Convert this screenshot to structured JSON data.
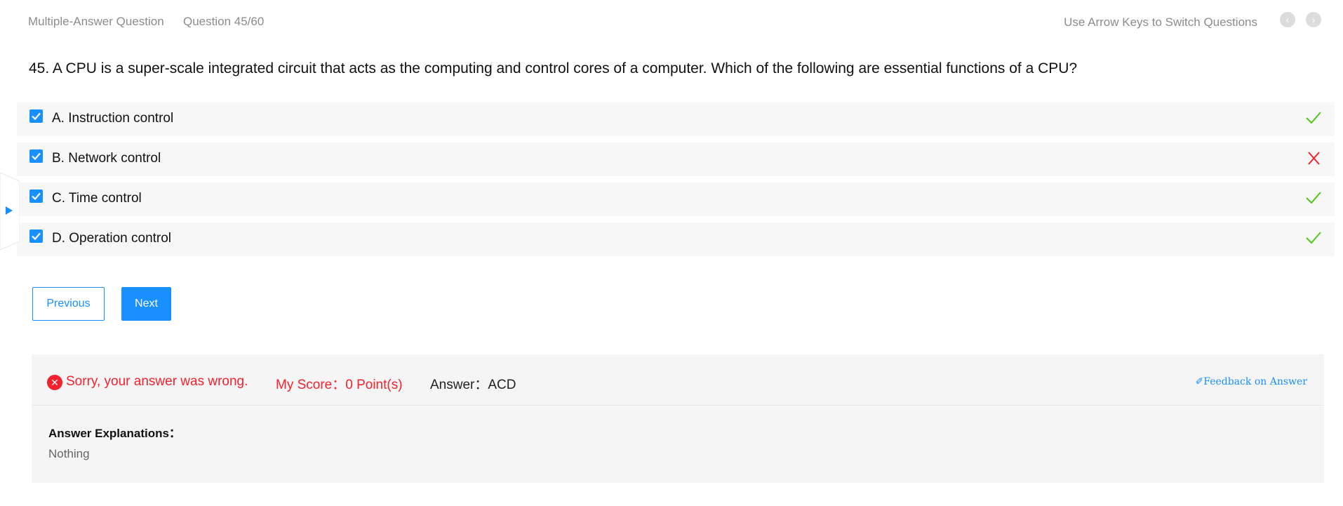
{
  "header": {
    "question_type": "Multiple-Answer Question",
    "question_counter": "Question 45/60",
    "switch_hint": "Use Arrow Keys to Switch Questions",
    "prev_icon": "‹",
    "next_icon": "›"
  },
  "question": {
    "text": "45. A CPU is a super-scale integrated circuit that acts as the computing and control cores of a computer. Which of the following are essential functions of a CPU?"
  },
  "options": [
    {
      "label": "A. Instruction control",
      "checked": true,
      "result": "correct"
    },
    {
      "label": "B. Network control",
      "checked": true,
      "result": "incorrect"
    },
    {
      "label": "C. Time control",
      "checked": true,
      "result": "correct"
    },
    {
      "label": "D. Operation control",
      "checked": true,
      "result": "correct"
    }
  ],
  "buttons": {
    "previous": "Previous",
    "next": "Next"
  },
  "result": {
    "error_icon": "✕",
    "message": "Sorry, your answer was wrong.",
    "score": "My Score：0 Point(s)",
    "answer": "Answer：ACD",
    "feedback": "✐Feedback on Answer",
    "explanation_title": "Answer Explanations：",
    "explanation_text": "Nothing"
  },
  "colors": {
    "accent": "#1890ff",
    "correct": "#52c41a",
    "incorrect": "#f5222d"
  }
}
